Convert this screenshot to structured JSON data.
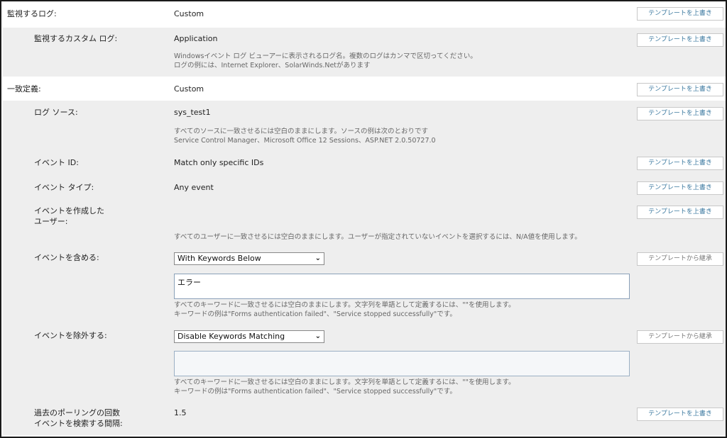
{
  "rows": {
    "monitor_log": {
      "label": "監視するログ:",
      "value": "Custom",
      "button": "テンプレートを上書き"
    },
    "custom_log": {
      "label": "監視するカスタム ログ:",
      "value": "Application",
      "button": "テンプレートを上書き",
      "hint": [
        "Windowsイベント ログ ビューアーに表示されるログ名。複数のログはカンマで区切ってください。",
        "ログの例には、Internet Explorer、SolarWinds.Netがあります"
      ]
    },
    "match_def": {
      "label": "一致定義:",
      "value": "Custom",
      "button": "テンプレートを上書き"
    },
    "log_source": {
      "label": "ログ ソース:",
      "value": "sys_test1",
      "button": "テンプレートを上書き",
      "hint": [
        "すべてのソースに一致させるには空白のままにします。ソースの例は次のとおりです",
        "Service Control Manager、Microsoft Office 12 Sessions、ASP.NET 2.0.50727.0"
      ]
    },
    "event_id": {
      "label": "イベント ID:",
      "value": "Match only specific IDs",
      "button": "テンプレートを上書き"
    },
    "event_type": {
      "label": "イベント タイプ:",
      "value": "Any event",
      "button": "テンプレートを上書き"
    },
    "event_user": {
      "label_line1": "イベントを作成した",
      "label_line2": "ユーザー:",
      "button": "テンプレートを上書き",
      "hint": "すべてのユーザーに一致させるには空白のままにします。ユーザーが指定されていないイベントを選択するには、N/A値を使用します。"
    },
    "include": {
      "label": "イベントを含める:",
      "select": "With Keywords Below",
      "textarea": "エラー",
      "button": "テンプレートから継承",
      "hint": [
        "すべてのキーワードに一致させるには空白のままにします。文字列を単語として定義するには、\"\"を使用します。",
        "キーワードの例は\"Forms authentication failed\"、\"Service stopped successfully\"です。"
      ]
    },
    "exclude": {
      "label": "イベントを除外する:",
      "select": "Disable Keywords Matching",
      "textarea": "",
      "button": "テンプレートから継承",
      "hint": [
        "すべてのキーワードに一致させるには空白のままにします。文字列を単語として定義するには、\"\"を使用します。",
        "キーワードの例は\"Forms authentication failed\"、\"Service stopped successfully\"です。"
      ]
    },
    "polling": {
      "label_line1": "過去のポーリングの回数",
      "label_line2": "イベントを検索する間隔:",
      "value": "1.5",
      "button": "テンプレートを上書き"
    }
  },
  "icons": {
    "select_chevron": "chevron-down-icon"
  }
}
